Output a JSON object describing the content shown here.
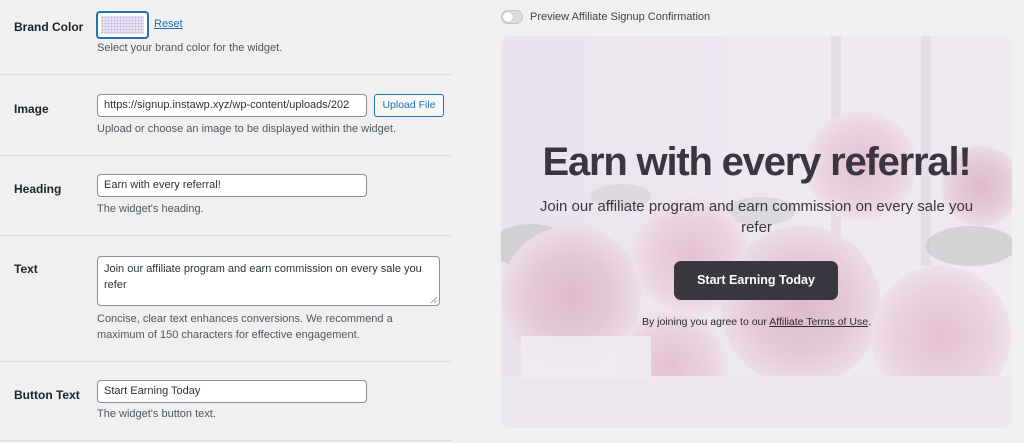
{
  "settings": {
    "brand_color": {
      "label": "Brand Color",
      "value_color": "#e9e3f4",
      "reset_label": "Reset",
      "description": "Select your brand color for the widget."
    },
    "image": {
      "label": "Image",
      "value": "https://signup.instawp.xyz/wp-content/uploads/202",
      "upload_label": "Upload File",
      "description": "Upload or choose an image to be displayed within the widget."
    },
    "heading": {
      "label": "Heading",
      "value": "Earn with every referral!",
      "description": "The widget's heading."
    },
    "text": {
      "label": "Text",
      "value": "Join our affiliate program and earn commission on every sale you refer",
      "description_line1": "Concise, clear text enhances conversions. We recommend a",
      "description_line2": "maximum of 150 characters for effective engagement."
    },
    "button_text": {
      "label": "Button Text",
      "value": "Start Earning Today",
      "description": "The widget's button text."
    }
  },
  "preview": {
    "toggle_label": "Preview Affiliate Signup Confirmation",
    "toggle_on": false,
    "heading": "Earn with every referral!",
    "text": "Join our affiliate program and earn commission on every sale you refer",
    "button_label": "Start Earning Today",
    "terms_prefix": "By joining you agree to our ",
    "terms_link": "Affiliate Terms of Use",
    "terms_suffix": ".",
    "button_color": "#3b3740"
  },
  "colors": {
    "accent": "#2271b1",
    "page_background": "#f0f0f1"
  }
}
